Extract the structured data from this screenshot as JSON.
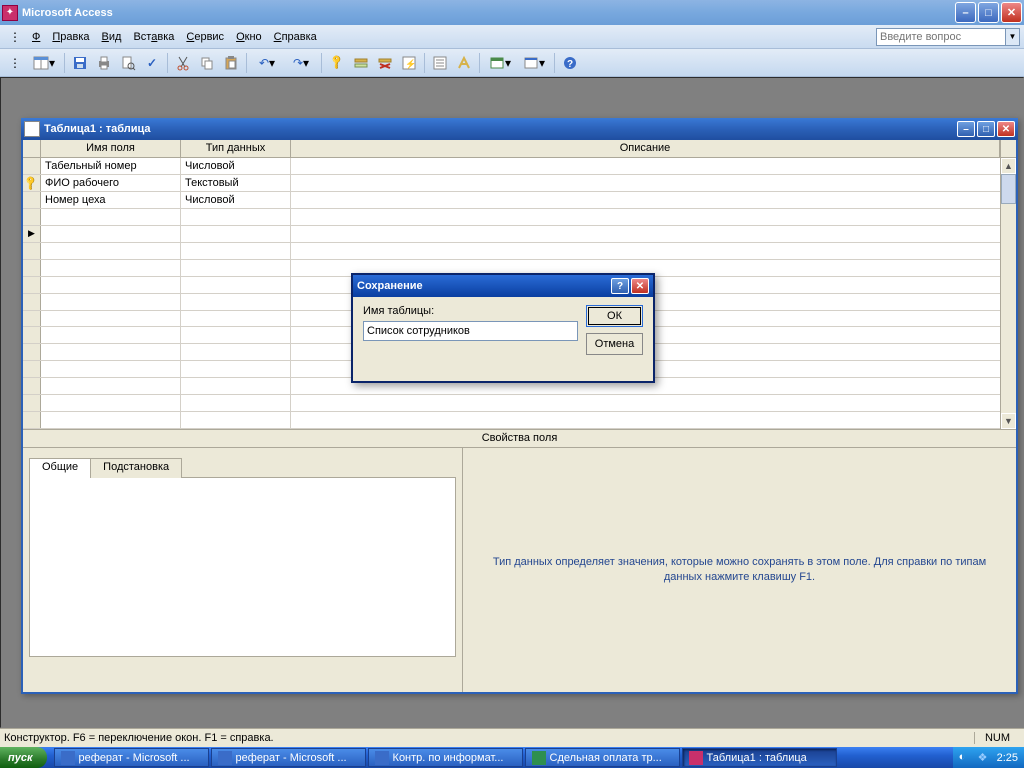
{
  "app": {
    "title": "Microsoft Access"
  },
  "menu": {
    "items": [
      "Файл",
      "Правка",
      "Вид",
      "Вставка",
      "Сервис",
      "Окно",
      "Справка"
    ],
    "ask_placeholder": "Введите вопрос"
  },
  "childwin": {
    "title": "Таблица1 : таблица"
  },
  "grid": {
    "headers": {
      "name": "Имя поля",
      "type": "Тип данных",
      "desc": "Описание"
    },
    "rows": [
      {
        "selector": "",
        "name": "Табельный номер",
        "type": "Числовой",
        "desc": ""
      },
      {
        "selector": "key",
        "name": "ФИО рабочего",
        "type": "Текстовый",
        "desc": ""
      },
      {
        "selector": "",
        "name": "Номер цеха",
        "type": "Числовой",
        "desc": ""
      },
      {
        "selector": "",
        "name": "",
        "type": "",
        "desc": ""
      },
      {
        "selector": "cur",
        "name": "",
        "type": "",
        "desc": ""
      },
      {
        "selector": "",
        "name": "",
        "type": "",
        "desc": ""
      },
      {
        "selector": "",
        "name": "",
        "type": "",
        "desc": ""
      },
      {
        "selector": "",
        "name": "",
        "type": "",
        "desc": ""
      },
      {
        "selector": "",
        "name": "",
        "type": "",
        "desc": ""
      },
      {
        "selector": "",
        "name": "",
        "type": "",
        "desc": ""
      },
      {
        "selector": "",
        "name": "",
        "type": "",
        "desc": ""
      },
      {
        "selector": "",
        "name": "",
        "type": "",
        "desc": ""
      },
      {
        "selector": "",
        "name": "",
        "type": "",
        "desc": ""
      },
      {
        "selector": "",
        "name": "",
        "type": "",
        "desc": ""
      },
      {
        "selector": "",
        "name": "",
        "type": "",
        "desc": ""
      },
      {
        "selector": "",
        "name": "",
        "type": "",
        "desc": ""
      }
    ]
  },
  "props": {
    "caption": "Свойства поля",
    "tab_general": "Общие",
    "tab_lookup": "Подстановка",
    "help": "Тип данных определяет значения, которые можно сохранять в этом поле.  Для справки по типам данных нажмите клавишу F1."
  },
  "dialog": {
    "title": "Сохранение",
    "label": "Имя таблицы:",
    "value": "Список сотрудников",
    "ok": "ОК",
    "cancel": "Отмена"
  },
  "status": {
    "text": "Конструктор.  F6 = переключение окон.  F1 = справка.",
    "num": "NUM"
  },
  "taskbar": {
    "start": "пуск",
    "tasks": [
      {
        "label": "реферат - Microsoft ...",
        "icon": "#3a6cc8"
      },
      {
        "label": "реферат - Microsoft ...",
        "icon": "#3a6cc8"
      },
      {
        "label": "Контр. по информат...",
        "icon": "#3a6cc8"
      },
      {
        "label": "Сдельная оплата тр...",
        "icon": "#2e8f4f"
      },
      {
        "label": "Таблица1 : таблица",
        "icon": "#c9306b",
        "active": true
      }
    ],
    "clock": "2:25"
  }
}
